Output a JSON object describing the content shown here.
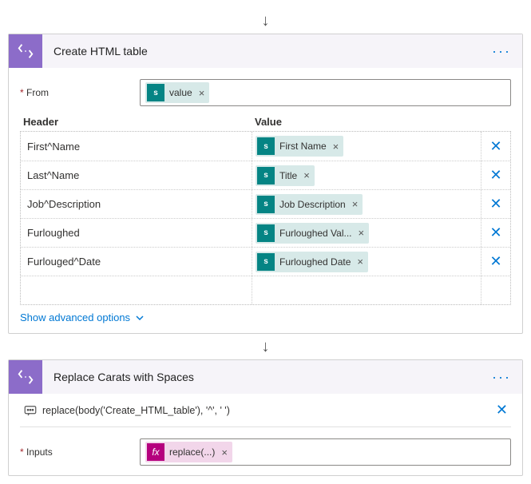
{
  "step1": {
    "title": "Create HTML table",
    "from_label": "From",
    "from_chip": "value",
    "headers_label": "Header",
    "values_label": "Value",
    "rows": [
      {
        "header": "First^Name",
        "value_chip": "First Name"
      },
      {
        "header": "Last^Name",
        "value_chip": "Title"
      },
      {
        "header": "Job^Description",
        "value_chip": "Job Description"
      },
      {
        "header": "Furloughed",
        "value_chip": "Furloughed Val..."
      },
      {
        "header": "Furlouged^Date",
        "value_chip": "Furloughed Date"
      }
    ],
    "advanced": "Show advanced options"
  },
  "step2": {
    "title": "Replace Carats with Spaces",
    "code": "replace(body('Create_HTML_table'), '^', ' ')",
    "inputs_label": "Inputs",
    "inputs_chip": "replace(...)"
  }
}
